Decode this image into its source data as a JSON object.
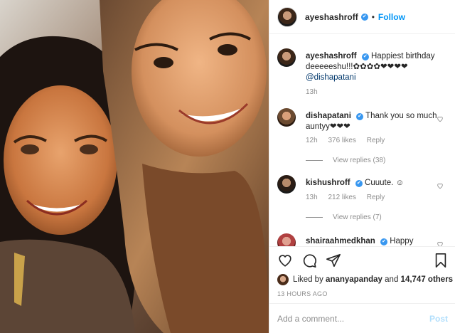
{
  "header": {
    "username": "ayeshashroff",
    "verified_mark": "✔",
    "separator": "•",
    "follow_label": "Follow"
  },
  "caption": {
    "username": "ayeshashroff",
    "text": "Happiest birthday deeeeeshu!!!✿✿✿✿❤❤❤❤",
    "mention": "@dishapatani",
    "time": "13h"
  },
  "comments": [
    {
      "username": "dishapatani",
      "verified": true,
      "text": "Thank you so much auntyy❤❤❤",
      "time": "12h",
      "likes": "376 likes",
      "reply": "Reply",
      "view_replies": "View replies (38)"
    },
    {
      "username": "kishushroff",
      "verified": true,
      "text": "Cuuute. ☺",
      "time": "13h",
      "likes": "212 likes",
      "reply": "Reply",
      "view_replies": "View replies (7)"
    },
    {
      "username": "shairaahmedkhan",
      "verified": true,
      "text": "Happy"
    }
  ],
  "likes": {
    "prefix": "Liked by ",
    "user": "ananyapanday",
    "middle": " and ",
    "count": "14,747 others"
  },
  "timestamp": "13 HOURS AGO",
  "add_comment": {
    "placeholder": "Add a comment...",
    "post_label": "Post"
  },
  "icons": [
    "heart-icon",
    "comment-icon",
    "share-icon",
    "bookmark-icon"
  ],
  "colors": {
    "link": "#0095f6",
    "muted": "#8e8e8e",
    "text": "#262626"
  }
}
